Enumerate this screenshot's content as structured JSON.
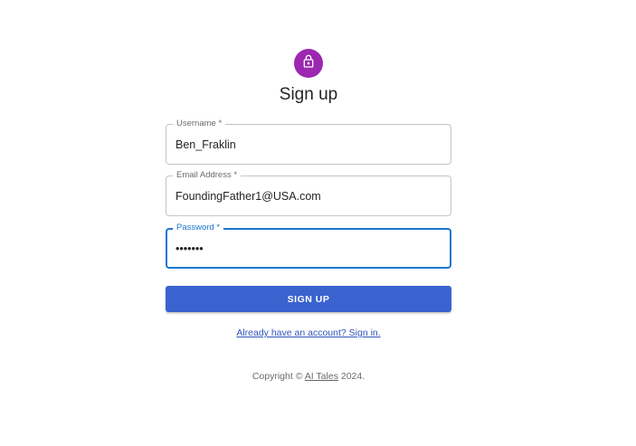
{
  "header": {
    "icon": "lock-icon",
    "title": "Sign up",
    "avatar_color": "#9c27b0"
  },
  "form": {
    "username": {
      "label": "Username *",
      "value": "Ben_Fraklin"
    },
    "email": {
      "label": "Email Address *",
      "value": "FoundingFather1@USA.com"
    },
    "password": {
      "label": "Password *",
      "value": "•••••••",
      "focused": true
    },
    "submit_label": "Sign Up",
    "accent_color": "#1976d2",
    "button_color": "#3a63cf"
  },
  "signin_link": "Already have an account? Sign in.",
  "footer": {
    "prefix": "Copyright © ",
    "link": "AI Tales",
    "suffix": " 2024."
  }
}
